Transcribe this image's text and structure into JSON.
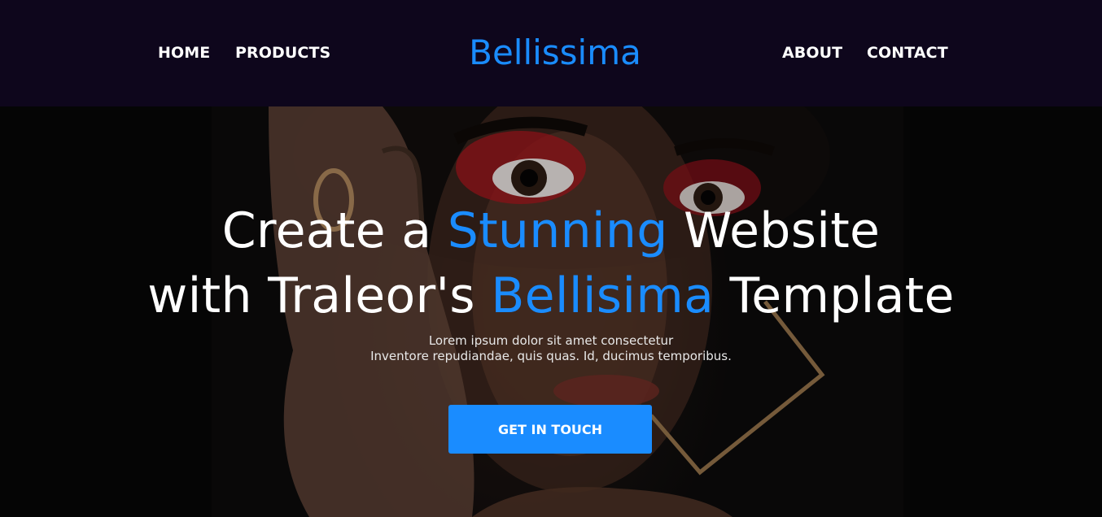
{
  "nav": {
    "home": "HOME",
    "products": "PRODUCTS",
    "brand": "Bellissima",
    "about": "ABOUT",
    "contact": "CONTACT"
  },
  "hero": {
    "title_line1_a": "Create a ",
    "title_line1_accent": "Stunning",
    "title_line1_b": " Website",
    "title_line2_a": "with Traleor's ",
    "title_line2_accent": "Bellisima",
    "title_line2_b": " Template",
    "subtitle_line1": "Lorem ipsum dolor sit amet consectetur",
    "subtitle_line2": "Inventore repudiandae, quis quas. Id, ducimus temporibus.",
    "cta_label": "GET IN TOUCH"
  },
  "colors": {
    "accent": "#1a8cff",
    "navbar_bg": "#0e061c",
    "text": "#ffffff"
  }
}
